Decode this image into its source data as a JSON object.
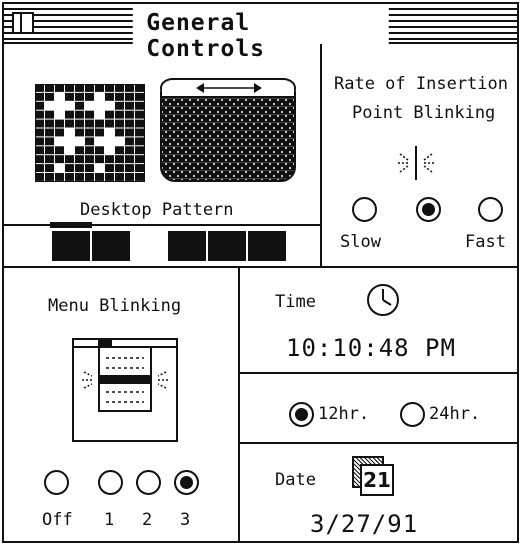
{
  "window": {
    "title": "General Controls"
  },
  "desktop_pattern": {
    "label": "Desktop Pattern",
    "swatch_count": 6,
    "pattern_grid": [
      "11111111111",
      "11011101111",
      "10001000111",
      "11011101111",
      "11111111111",
      "11101110111",
      "11000100011",
      "11101110111",
      "11111111111",
      "11011101111",
      "11111111111"
    ]
  },
  "insertion_point": {
    "heading_line1": "Rate of Insertion",
    "heading_line2": "Point Blinking",
    "options": [
      "Slow",
      "Medium",
      "Fast"
    ],
    "labels": {
      "slow": "Slow",
      "fast": "Fast"
    },
    "selected": "Medium"
  },
  "menu_blinking": {
    "heading": "Menu Blinking",
    "options": [
      "Off",
      "1",
      "2",
      "3"
    ],
    "selected": "3"
  },
  "time": {
    "label": "Time",
    "value": "10:10:48 PM",
    "format_12": "12hr.",
    "format_24": "24hr.",
    "selected_format": "12hr."
  },
  "date": {
    "label": "Date",
    "value": "3/27/91",
    "icon_day": "21"
  }
}
